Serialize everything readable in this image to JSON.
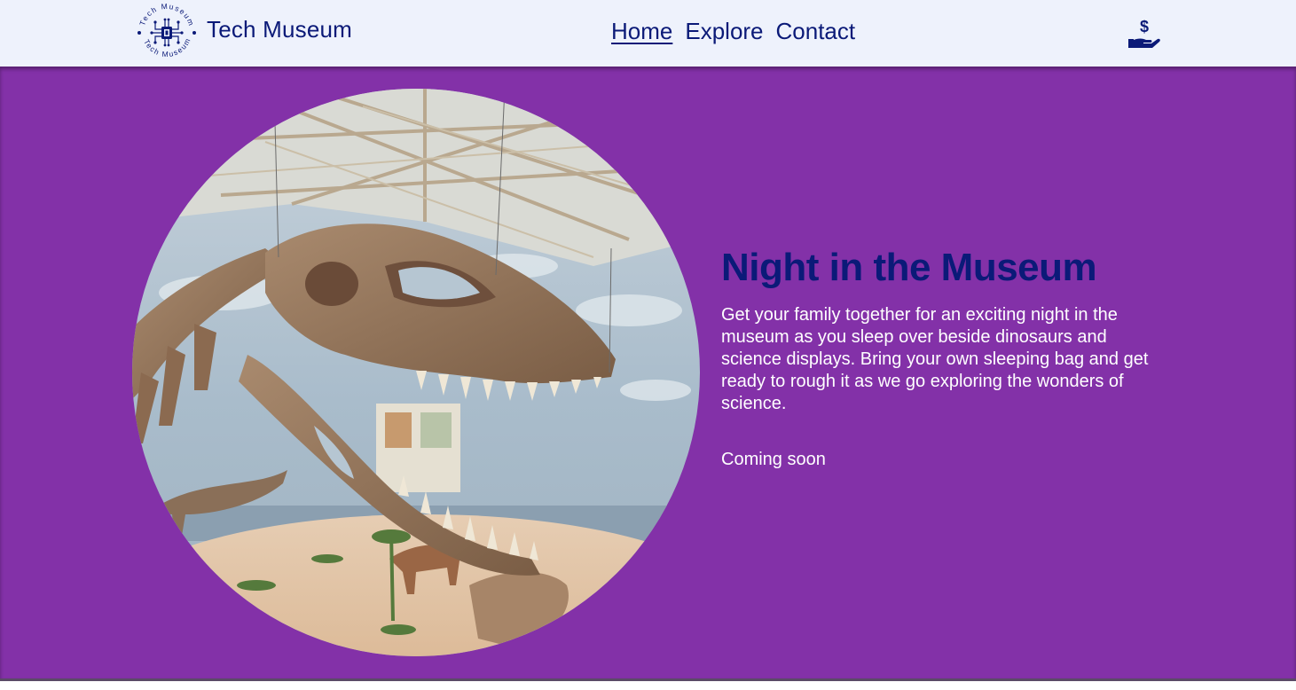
{
  "header": {
    "logo_ring_text": "Tech Museum",
    "site_title": "Tech Museum",
    "nav": [
      {
        "label": "Home",
        "active": true
      },
      {
        "label": "Explore",
        "active": false
      },
      {
        "label": "Contact",
        "active": false
      }
    ],
    "donate_icon": "hand-dollar-icon"
  },
  "hero": {
    "image": "dinosaur-skeleton-photo",
    "title": "Night in the Museum",
    "description": "Get your family together for an exciting night in the museum as you sleep over beside dinosaurs and science displays. Bring your own sleeping bag and get ready to rough it as we go exploring the wonders of science.",
    "status": "Coming soon"
  },
  "colors": {
    "header_bg": "#eef2fc",
    "brand_navy": "#0b1a78",
    "hero_bg": "#8331a8",
    "hero_text": "#ffffff"
  }
}
